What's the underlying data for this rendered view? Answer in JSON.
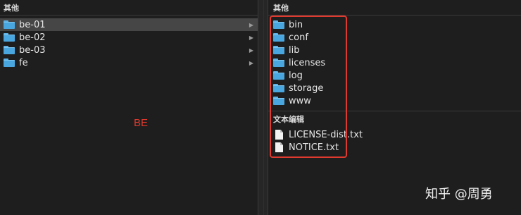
{
  "left_pane": {
    "header": "其他",
    "items": [
      {
        "label": "be-01",
        "selected": true
      },
      {
        "label": "be-02",
        "selected": false
      },
      {
        "label": "be-03",
        "selected": false
      },
      {
        "label": "fe",
        "selected": false
      }
    ]
  },
  "right_pane": {
    "header": "其他",
    "folders": [
      {
        "label": "bin"
      },
      {
        "label": "conf"
      },
      {
        "label": "lib"
      },
      {
        "label": "licenses"
      },
      {
        "label": "log"
      },
      {
        "label": "storage"
      },
      {
        "label": "www"
      }
    ],
    "text_group_header": "文本编辑",
    "files": [
      {
        "label": "LICENSE-dist.txt"
      },
      {
        "label": "NOTICE.txt"
      }
    ]
  },
  "annotation": {
    "label": "BE",
    "color": "#e0392d",
    "box_color": "#e03a2f"
  },
  "watermark": {
    "text": "知乎 @周勇"
  },
  "icons": {
    "folder": "folder-icon",
    "document": "text-document-icon",
    "chevron": "chevron-right-icon"
  },
  "colors": {
    "background": "#1e1e1e",
    "selection": "#464646",
    "folder_blue": "#4aa6de"
  }
}
